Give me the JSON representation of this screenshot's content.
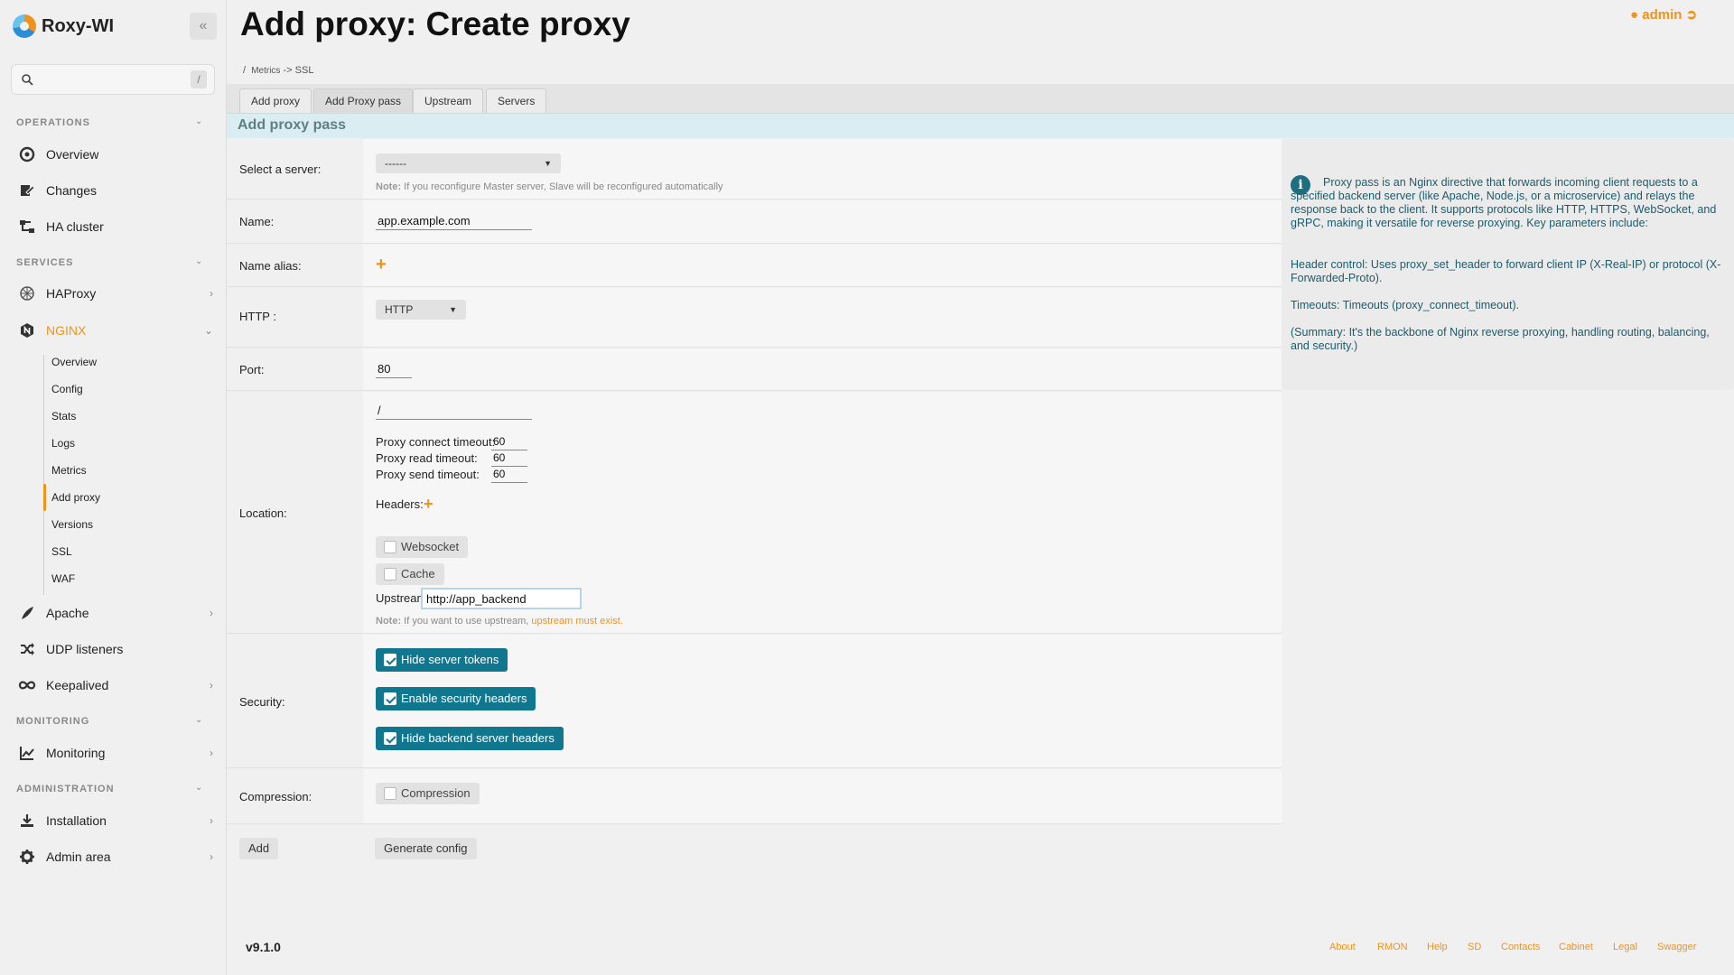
{
  "app": {
    "name": "Roxy-WI",
    "version": "v9.1.0"
  },
  "user": {
    "name": "admin"
  },
  "search": {
    "placeholder": "",
    "shortcut": "/"
  },
  "sidebar": {
    "sections": {
      "operations": "OPERATIONS",
      "services": "SERVICES",
      "monitoring": "MONITORING",
      "administration": "ADMINISTRATION"
    },
    "items": {
      "overview": "Overview",
      "changes": "Changes",
      "ha_cluster": "HA cluster",
      "haproxy": "HAProxy",
      "nginx": "NGINX",
      "apache": "Apache",
      "udp": "UDP listeners",
      "keepalived": "Keepalived",
      "monitoring": "Monitoring",
      "installation": "Installation",
      "admin_area": "Admin area"
    },
    "nginx_sub": [
      "Overview",
      "Config",
      "Stats",
      "Logs",
      "Metrics",
      "Add proxy",
      "Versions",
      "SSL",
      "WAF"
    ]
  },
  "page": {
    "title": "Add proxy: Create proxy"
  },
  "breadcrumb": {
    "sep": "/",
    "metrics": "Metrics",
    "arrow": "->",
    "ssl": "SSL"
  },
  "tabs": [
    "Add proxy",
    "Add Proxy pass",
    "Upstream",
    "Servers"
  ],
  "section": {
    "title": "Add proxy pass"
  },
  "form": {
    "server": {
      "label": "Select a server:",
      "value": "------",
      "note_bold": "Note:",
      "note": " If you reconfigure Master server, Slave will be reconfigured automatically"
    },
    "name": {
      "label": "Name:",
      "value": "app.example.com"
    },
    "alias": {
      "label": "Name alias:"
    },
    "http": {
      "label": "HTTP :",
      "value": "HTTP"
    },
    "port": {
      "label": "Port:",
      "value": "80"
    },
    "location": {
      "label": "Location:",
      "path": "/",
      "connect_label": "Proxy connect timeout:",
      "connect_value": "60",
      "read_label": "Proxy read timeout:",
      "read_value": "60",
      "send_label": "Proxy send timeout:",
      "send_value": "60",
      "headers_label": "Headers:",
      "websocket": "Websocket",
      "cache": "Cache",
      "upstream_label": "Upstream:",
      "upstream_value": "http://app_backend",
      "note_bold": "Note:",
      "note": " If you want to use upstream, ",
      "note_link": "upstream must exist."
    },
    "security": {
      "label": "Security:",
      "hide_tokens": "Hide server tokens",
      "security_headers": "Enable security headers",
      "hide_backend": "Hide backend server headers"
    },
    "compression": {
      "label": "Compression:",
      "option": "Compression"
    },
    "buttons": {
      "add": "Add",
      "generate": "Generate config"
    }
  },
  "info": {
    "p1": "Proxy pass is an Nginx directive that forwards incoming client requests to a specified backend server (like Apache, Node.js, or a microservice) and relays the response back to the client. It supports protocols like HTTP, HTTPS, WebSocket, and gRPC, making it versatile for reverse proxying. Key parameters include:",
    "p2": "Header control: Uses proxy_set_header to forward client IP (X-Real-IP) or protocol (X-Forwarded-Proto).",
    "p3": "Timeouts: Timeouts (proxy_connect_timeout).",
    "p4": "(Summary: It's the backbone of Nginx reverse proxying, handling routing, balancing, and security.)"
  },
  "footer": [
    "About",
    "RMON",
    "Help",
    "SD",
    "Contacts",
    "Cabinet",
    "Legal",
    "Swagger"
  ],
  "colors": {
    "accent": "#f0931c",
    "teal": "#11778f"
  }
}
